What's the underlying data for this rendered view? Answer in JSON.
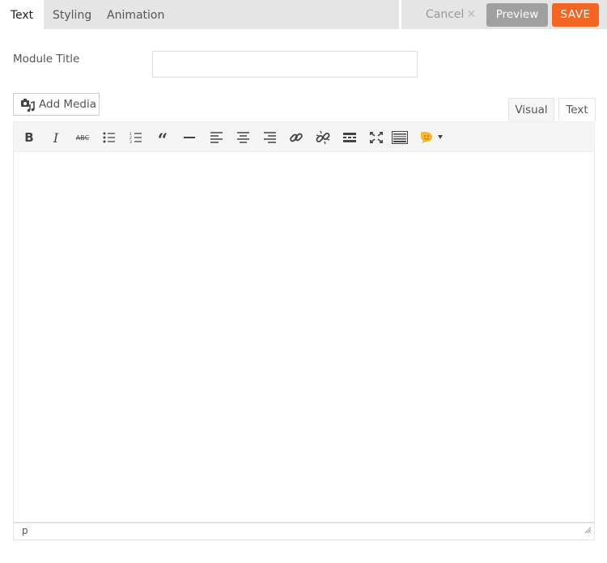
{
  "tabs": [
    {
      "label": "Text",
      "active": true
    },
    {
      "label": "Styling",
      "active": false
    },
    {
      "label": "Animation",
      "active": false
    }
  ],
  "actions": {
    "cancel_label": "Cancel",
    "cancel_icon": "close-icon",
    "preview_label": "Preview",
    "save_label": "SAVE"
  },
  "colors": {
    "save": "#f26522",
    "preview": "#a0a0a0",
    "topbar": "#e5e5e5"
  },
  "form": {
    "module_title_label": "Module Title",
    "module_title_value": ""
  },
  "editor": {
    "add_media_label": "Add Media",
    "mode_tabs": [
      "Visual",
      "Text"
    ],
    "active_mode": "Visual",
    "toolbar": [
      {
        "name": "bold",
        "icon": "bold-icon"
      },
      {
        "name": "italic",
        "icon": "italic-icon"
      },
      {
        "name": "strikethrough",
        "icon": "strikethrough-icon"
      },
      {
        "name": "bulleted-list",
        "icon": "bulleted-list-icon"
      },
      {
        "name": "numbered-list",
        "icon": "numbered-list-icon"
      },
      {
        "name": "blockquote",
        "icon": "blockquote-icon"
      },
      {
        "name": "horizontal-line",
        "icon": "horizontal-line-icon"
      },
      {
        "name": "align-left",
        "icon": "align-left-icon"
      },
      {
        "name": "align-center",
        "icon": "align-center-icon"
      },
      {
        "name": "align-right",
        "icon": "align-right-icon"
      },
      {
        "name": "insert-link",
        "icon": "link-icon"
      },
      {
        "name": "remove-link",
        "icon": "unlink-icon"
      },
      {
        "name": "read-more",
        "icon": "read-more-icon"
      },
      {
        "name": "fullscreen",
        "icon": "fullscreen-icon"
      },
      {
        "name": "toolbar-toggle",
        "icon": "keyboard-icon"
      },
      {
        "name": "emoticons",
        "icon": "emoticon-icon"
      }
    ],
    "content": "",
    "status_path": "p"
  }
}
